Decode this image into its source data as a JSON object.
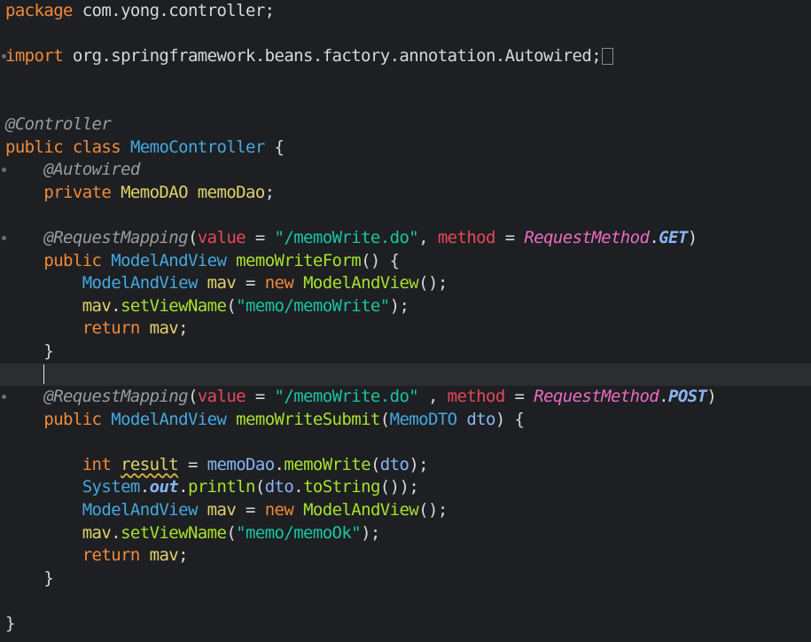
{
  "editor": {
    "colors": {
      "background": "#1e1f22",
      "keyword": "#f08a3a",
      "type": "#44a8e0",
      "annotation": "#9c9c9c",
      "string": "#17c6a3",
      "method": "#a6e22e",
      "field": "#8ab4f8",
      "constant": "#ee6bc2",
      "attribute": "#e8475b",
      "identifier": "#e0d26c",
      "default": "#d8d8d8"
    },
    "current_line": 16,
    "lines": [
      {
        "fold": false,
        "tokens": [
          {
            "t": "package",
            "c": "keyword"
          },
          {
            "t": " com.yong.controller;",
            "c": "default"
          }
        ]
      },
      {
        "fold": false,
        "tokens": []
      },
      {
        "fold": true,
        "tokens": [
          {
            "t": "import",
            "c": "keyword"
          },
          {
            "t": " org.springframework.beans.factory.annotation.Autowired;",
            "c": "default"
          },
          {
            "t": "",
            "c": "collapse-box"
          }
        ]
      },
      {
        "fold": false,
        "tokens": []
      },
      {
        "fold": false,
        "tokens": []
      },
      {
        "fold": false,
        "tokens": [
          {
            "t": "@Controller",
            "c": "annotation",
            "s": "italic"
          }
        ]
      },
      {
        "fold": false,
        "tokens": [
          {
            "t": "public",
            "c": "keyword"
          },
          {
            "t": " ",
            "c": "default"
          },
          {
            "t": "class",
            "c": "keyword"
          },
          {
            "t": " ",
            "c": "default"
          },
          {
            "t": "MemoController",
            "c": "type"
          },
          {
            "t": " {",
            "c": "default"
          }
        ]
      },
      {
        "fold": true,
        "tokens": [
          {
            "t": "    ",
            "c": "default"
          },
          {
            "t": "@Autowired",
            "c": "annotation",
            "s": "italic"
          }
        ]
      },
      {
        "fold": false,
        "tokens": [
          {
            "t": "    ",
            "c": "default"
          },
          {
            "t": "private",
            "c": "keyword"
          },
          {
            "t": " ",
            "c": "default"
          },
          {
            "t": "MemoDAO",
            "c": "identifier"
          },
          {
            "t": " ",
            "c": "default"
          },
          {
            "t": "memoDao",
            "c": "identifier"
          },
          {
            "t": ";",
            "c": "default"
          }
        ]
      },
      {
        "fold": false,
        "tokens": []
      },
      {
        "fold": true,
        "tokens": [
          {
            "t": "    ",
            "c": "default"
          },
          {
            "t": "@RequestMapping",
            "c": "annotation",
            "s": "italic"
          },
          {
            "t": "(",
            "c": "default"
          },
          {
            "t": "value",
            "c": "attribute"
          },
          {
            "t": " = ",
            "c": "default"
          },
          {
            "t": "\"/memoWrite.do\"",
            "c": "string"
          },
          {
            "t": ", ",
            "c": "default"
          },
          {
            "t": "method",
            "c": "attribute"
          },
          {
            "t": " = ",
            "c": "default"
          },
          {
            "t": "RequestMethod",
            "c": "constant",
            "s": "italic"
          },
          {
            "t": ".",
            "c": "default"
          },
          {
            "t": "GET",
            "c": "field",
            "s": "bolditalic"
          },
          {
            "t": ")",
            "c": "default"
          }
        ]
      },
      {
        "fold": false,
        "tokens": [
          {
            "t": "    ",
            "c": "default"
          },
          {
            "t": "public",
            "c": "keyword"
          },
          {
            "t": " ",
            "c": "default"
          },
          {
            "t": "ModelAndView",
            "c": "type"
          },
          {
            "t": " ",
            "c": "default"
          },
          {
            "t": "memoWriteForm",
            "c": "method"
          },
          {
            "t": "() {",
            "c": "default"
          }
        ]
      },
      {
        "fold": false,
        "tokens": [
          {
            "t": "        ",
            "c": "default"
          },
          {
            "t": "ModelAndView",
            "c": "type"
          },
          {
            "t": " ",
            "c": "default"
          },
          {
            "t": "mav",
            "c": "identifier"
          },
          {
            "t": " = ",
            "c": "default"
          },
          {
            "t": "new",
            "c": "keyword"
          },
          {
            "t": " ",
            "c": "default"
          },
          {
            "t": "ModelAndView",
            "c": "method"
          },
          {
            "t": "();",
            "c": "default"
          }
        ]
      },
      {
        "fold": false,
        "tokens": [
          {
            "t": "        ",
            "c": "default"
          },
          {
            "t": "mav",
            "c": "identifier"
          },
          {
            "t": ".",
            "c": "default"
          },
          {
            "t": "setViewName",
            "c": "method"
          },
          {
            "t": "(",
            "c": "default"
          },
          {
            "t": "\"memo/memoWrite\"",
            "c": "string"
          },
          {
            "t": ");",
            "c": "default"
          }
        ]
      },
      {
        "fold": false,
        "tokens": [
          {
            "t": "        ",
            "c": "default"
          },
          {
            "t": "return",
            "c": "keyword"
          },
          {
            "t": " ",
            "c": "default"
          },
          {
            "t": "mav",
            "c": "identifier"
          },
          {
            "t": ";",
            "c": "default"
          }
        ]
      },
      {
        "fold": false,
        "tokens": [
          {
            "t": "    }",
            "c": "default"
          }
        ]
      },
      {
        "fold": false,
        "tokens": [
          {
            "t": "    ",
            "c": "default"
          },
          {
            "t": "",
            "c": "caret"
          }
        ]
      },
      {
        "fold": true,
        "tokens": [
          {
            "t": "    ",
            "c": "default"
          },
          {
            "t": "@RequestMapping",
            "c": "annotation",
            "s": "italic"
          },
          {
            "t": "(",
            "c": "default"
          },
          {
            "t": "value",
            "c": "attribute"
          },
          {
            "t": " = ",
            "c": "default"
          },
          {
            "t": "\"/memoWrite.do\"",
            "c": "string"
          },
          {
            "t": " , ",
            "c": "default"
          },
          {
            "t": "method",
            "c": "attribute"
          },
          {
            "t": " = ",
            "c": "default"
          },
          {
            "t": "RequestMethod",
            "c": "constant",
            "s": "italic"
          },
          {
            "t": ".",
            "c": "default"
          },
          {
            "t": "POST",
            "c": "field",
            "s": "bolditalic"
          },
          {
            "t": ")",
            "c": "default"
          }
        ]
      },
      {
        "fold": false,
        "tokens": [
          {
            "t": "    ",
            "c": "default"
          },
          {
            "t": "public",
            "c": "keyword"
          },
          {
            "t": " ",
            "c": "default"
          },
          {
            "t": "ModelAndView",
            "c": "type"
          },
          {
            "t": " ",
            "c": "default"
          },
          {
            "t": "memoWriteSubmit",
            "c": "method"
          },
          {
            "t": "(",
            "c": "default"
          },
          {
            "t": "MemoDTO",
            "c": "type"
          },
          {
            "t": " ",
            "c": "default"
          },
          {
            "t": "dto",
            "c": "field"
          },
          {
            "t": ") {",
            "c": "default"
          }
        ]
      },
      {
        "fold": false,
        "tokens": []
      },
      {
        "fold": false,
        "tokens": [
          {
            "t": "        ",
            "c": "default"
          },
          {
            "t": "int",
            "c": "keyword"
          },
          {
            "t": " ",
            "c": "default"
          },
          {
            "t": "result",
            "c": "identifier",
            "s": "underline"
          },
          {
            "t": " = ",
            "c": "default"
          },
          {
            "t": "memoDao",
            "c": "field"
          },
          {
            "t": ".",
            "c": "default"
          },
          {
            "t": "memoWrite",
            "c": "method"
          },
          {
            "t": "(",
            "c": "default"
          },
          {
            "t": "dto",
            "c": "field"
          },
          {
            "t": ");",
            "c": "default"
          }
        ]
      },
      {
        "fold": false,
        "tokens": [
          {
            "t": "        ",
            "c": "default"
          },
          {
            "t": "System",
            "c": "type"
          },
          {
            "t": ".",
            "c": "default"
          },
          {
            "t": "out",
            "c": "field",
            "s": "bolditalic"
          },
          {
            "t": ".",
            "c": "default"
          },
          {
            "t": "println",
            "c": "method"
          },
          {
            "t": "(",
            "c": "default"
          },
          {
            "t": "dto",
            "c": "field"
          },
          {
            "t": ".",
            "c": "default"
          },
          {
            "t": "toString",
            "c": "method"
          },
          {
            "t": "());",
            "c": "default"
          }
        ]
      },
      {
        "fold": false,
        "tokens": [
          {
            "t": "        ",
            "c": "default"
          },
          {
            "t": "ModelAndView",
            "c": "type"
          },
          {
            "t": " ",
            "c": "default"
          },
          {
            "t": "mav",
            "c": "identifier"
          },
          {
            "t": " = ",
            "c": "default"
          },
          {
            "t": "new",
            "c": "keyword"
          },
          {
            "t": " ",
            "c": "default"
          },
          {
            "t": "ModelAndView",
            "c": "method"
          },
          {
            "t": "();",
            "c": "default"
          }
        ]
      },
      {
        "fold": false,
        "tokens": [
          {
            "t": "        ",
            "c": "default"
          },
          {
            "t": "mav",
            "c": "identifier"
          },
          {
            "t": ".",
            "c": "default"
          },
          {
            "t": "setViewName",
            "c": "method"
          },
          {
            "t": "(",
            "c": "default"
          },
          {
            "t": "\"memo/memoOk\"",
            "c": "string"
          },
          {
            "t": ");",
            "c": "default"
          }
        ]
      },
      {
        "fold": false,
        "tokens": [
          {
            "t": "        ",
            "c": "default"
          },
          {
            "t": "return",
            "c": "keyword"
          },
          {
            "t": " ",
            "c": "default"
          },
          {
            "t": "mav",
            "c": "identifier"
          },
          {
            "t": ";",
            "c": "default"
          }
        ]
      },
      {
        "fold": false,
        "tokens": [
          {
            "t": "    }",
            "c": "default"
          }
        ]
      },
      {
        "fold": false,
        "tokens": []
      },
      {
        "fold": false,
        "tokens": [
          {
            "t": "}",
            "c": "default"
          }
        ]
      }
    ]
  }
}
